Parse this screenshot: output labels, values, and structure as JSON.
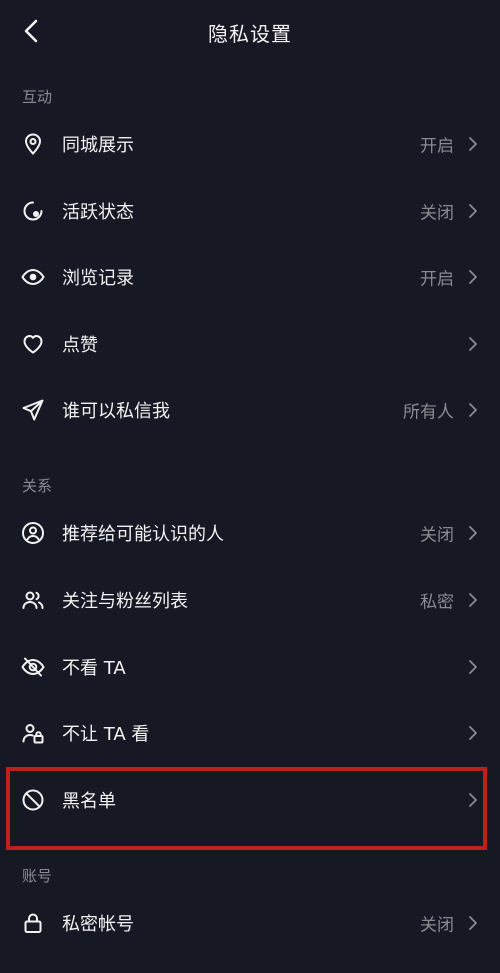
{
  "header": {
    "title": "隐私设置"
  },
  "sections": {
    "interaction": "互动",
    "relation": "关系",
    "account": "账号"
  },
  "rows": {
    "local_display": {
      "label": "同城展示",
      "value": "开启"
    },
    "activity_status": {
      "label": "活跃状态",
      "value": "关闭"
    },
    "browse_history": {
      "label": "浏览记录",
      "value": "开启"
    },
    "likes": {
      "label": "点赞",
      "value": ""
    },
    "who_can_message": {
      "label": "谁可以私信我",
      "value": "所有人"
    },
    "recommend_to_contacts": {
      "label": "推荐给可能认识的人",
      "value": "关闭"
    },
    "following_followers": {
      "label": "关注与粉丝列表",
      "value": "私密"
    },
    "hide_their_content": {
      "label": "不看 TA",
      "value": ""
    },
    "hide_from_them": {
      "label": "不让 TA 看",
      "value": ""
    },
    "blacklist": {
      "label": "黑名单",
      "value": ""
    },
    "private_account": {
      "label": "私密帐号",
      "value": "关闭"
    }
  },
  "colors": {
    "background": "#161823",
    "text": "#f2f2f3",
    "secondary_text": "#8a8b91",
    "highlight": "#c0201b"
  },
  "icons": {
    "back": "chevron-left-icon",
    "local_display": "location-pin-icon",
    "activity_status": "activity-circle-icon",
    "browse_history": "eye-icon",
    "likes": "heart-icon",
    "who_can_message": "paper-plane-icon",
    "recommend_to_contacts": "user-circle-icon",
    "following_followers": "users-icon",
    "hide_their_content": "eye-off-icon",
    "hide_from_them": "user-lock-icon",
    "blacklist": "block-icon",
    "private_account": "lock-icon"
  }
}
